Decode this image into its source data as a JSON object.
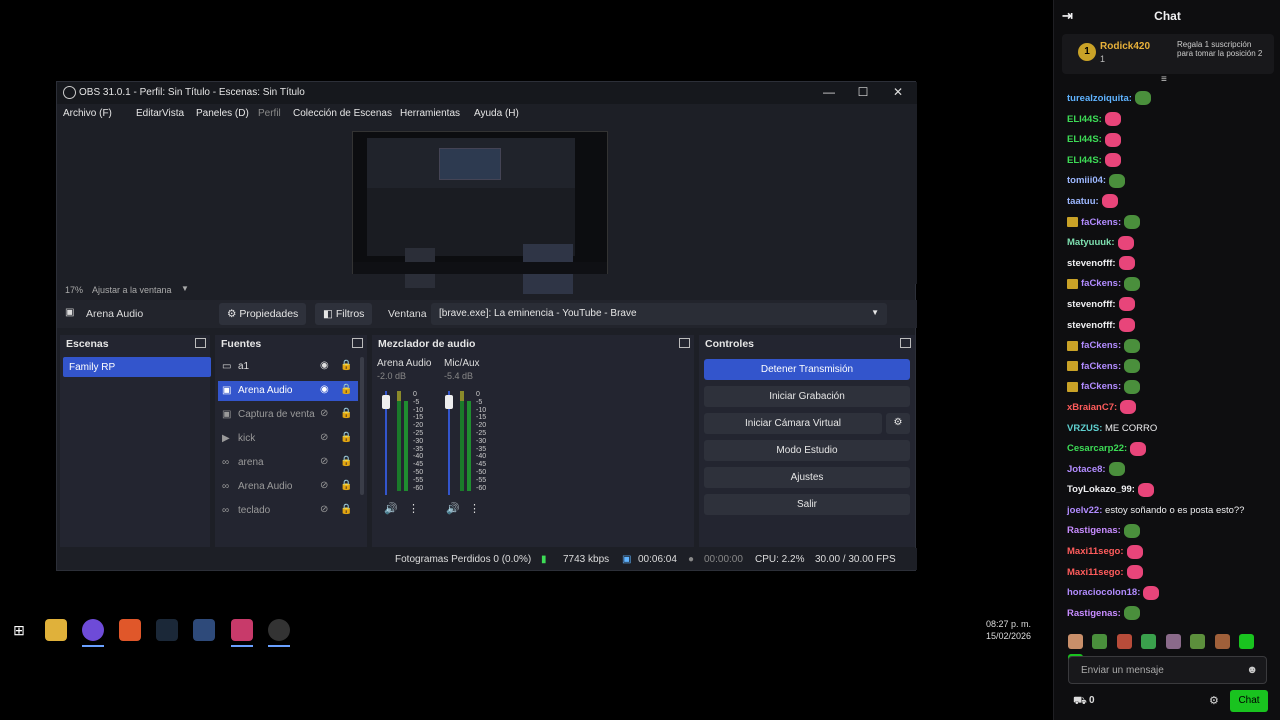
{
  "obs": {
    "title": "OBS 31.0.1 - Perfil: Sin Título - Escenas: Sin Título",
    "menu": [
      "Archivo (F)",
      "Editar",
      "Vista",
      "Paneles (D)",
      "Perfil",
      "Colección de Escenas",
      "Herramientas",
      "Ayuda (H)"
    ],
    "zoom": "17%",
    "fit_label": "Ajustar a la ventana",
    "selected_source": "Arena Audio",
    "properties": "Propiedades",
    "filters": "Filtros",
    "window_label": "Ventana",
    "window_value": "[brave.exe]: La eminencia - YouTube - Brave",
    "scenes_title": "Escenas",
    "scenes": [
      "Family RP"
    ],
    "sources_title": "Fuentes",
    "sources": [
      {
        "name": "a1",
        "icon": "▭"
      },
      {
        "name": "Arena Audio",
        "icon": "▣"
      },
      {
        "name": "Captura de venta",
        "icon": "▣"
      },
      {
        "name": "kick",
        "icon": "▶"
      },
      {
        "name": "arena",
        "icon": "∞"
      },
      {
        "name": "Arena Audio",
        "icon": "∞"
      },
      {
        "name": "teclado",
        "icon": "∞"
      }
    ],
    "mixer_title": "Mezclador de audio",
    "mixer": [
      {
        "name": "Arena Audio",
        "db": "-2.0 dB",
        "level": 0.35
      },
      {
        "name": "Mic/Aux",
        "db": "-5.4 dB",
        "level": 0.4
      }
    ],
    "scale": [
      "0",
      "-5",
      "-10",
      "-15",
      "-20",
      "-25",
      "-30",
      "-35",
      "-40",
      "-45",
      "-50",
      "-55",
      "-60"
    ],
    "controls_title": "Controles",
    "controls": [
      "Detener Transmisión",
      "Iniciar Grabación",
      "Iniciar Cámara Virtual",
      "Modo Estudio",
      "Ajustes",
      "Salir"
    ],
    "status": {
      "dropped": "Fotogramas Perdidos 0 (0.0%)",
      "bitrate": "7743 kbps",
      "stream_time": "00:06:04",
      "rec_time": "00:00:00",
      "cpu": "CPU: 2.2%",
      "fps": "30.00 / 30.00 FPS"
    }
  },
  "taskbar": {
    "time": "08:27 p. m.",
    "date": "15/02/2026"
  },
  "chat": {
    "title": "Chat",
    "pinned": {
      "rank": "1",
      "user": "Rodick420",
      "count": "1",
      "message": "Regala 1 suscripción para tomar la posición 2"
    },
    "messages": [
      {
        "user": "turealzoiquita:",
        "color": "#5fb3ff",
        "emote": "pepe",
        "text": ""
      },
      {
        "user": "ELI44S:",
        "color": "#3ddc56",
        "emote": "heart",
        "text": ""
      },
      {
        "user": "ELI44S:",
        "color": "#3ddc56",
        "emote": "heart",
        "text": ""
      },
      {
        "user": "ELI44S:",
        "color": "#3ddc56",
        "emote": "heart",
        "text": ""
      },
      {
        "user": "tomiii04:",
        "color": "#9db8ff",
        "emote": "pepe",
        "text": ""
      },
      {
        "user": "taatuu:",
        "color": "#9db8ff",
        "emote": "heart",
        "text": ""
      },
      {
        "user": "faCkens:",
        "color": "#b28cff",
        "badge": true,
        "emote": "pepe",
        "text": ""
      },
      {
        "user": "Matyuuuk:",
        "color": "#7ee0b0",
        "emote": "heart",
        "text": ""
      },
      {
        "user": "stevenofff:",
        "color": "#efeff1",
        "emote": "heart",
        "text": ""
      },
      {
        "user": "faCkens:",
        "color": "#b28cff",
        "badge": true,
        "emote": "pepe",
        "text": ""
      },
      {
        "user": "stevenofff:",
        "color": "#efeff1",
        "emote": "heart",
        "text": ""
      },
      {
        "user": "stevenofff:",
        "color": "#efeff1",
        "emote": "heart",
        "text": ""
      },
      {
        "user": "faCkens:",
        "color": "#b28cff",
        "badge": true,
        "emote": "pepe",
        "text": ""
      },
      {
        "user": "faCkens:",
        "color": "#b28cff",
        "badge": true,
        "emote": "pepe",
        "text": ""
      },
      {
        "user": "faCkens:",
        "color": "#b28cff",
        "badge": true,
        "emote": "pepe",
        "text": ""
      },
      {
        "user": "xBraianC7:",
        "color": "#ff5c5c",
        "emote": "heart",
        "text": ""
      },
      {
        "user": "VRZUS:",
        "color": "#5fd0d0",
        "emote": "",
        "text": "ME CORRO"
      },
      {
        "user": "Cesarcarp22:",
        "color": "#3ddc56",
        "emote": "heart",
        "text": ""
      },
      {
        "user": "Jotace8:",
        "color": "#b28cff",
        "emote": "pepe",
        "text": ""
      },
      {
        "user": "ToyLokazo_99:",
        "color": "#efeff1",
        "emote": "heart",
        "text": ""
      },
      {
        "user": "joelv22:",
        "color": "#b28cff",
        "emote": "",
        "text": "estoy soñando o es posta esto??"
      },
      {
        "user": "Rastigenas:",
        "color": "#c78cff",
        "emote": "pepe",
        "text": ""
      },
      {
        "user": "Maxi11sego:",
        "color": "#ff5c5c",
        "emote": "heart",
        "text": ""
      },
      {
        "user": "Maxi11sego:",
        "color": "#ff5c5c",
        "emote": "heart",
        "text": ""
      },
      {
        "user": "horaciocolon18:",
        "color": "#b28cff",
        "emote": "heart",
        "text": ""
      },
      {
        "user": "Rastigenas:",
        "color": "#c78cff",
        "emote": "pepe",
        "text": ""
      }
    ],
    "input_placeholder": "Enviar un mensaje",
    "points": "0",
    "send_label": "Chat"
  }
}
